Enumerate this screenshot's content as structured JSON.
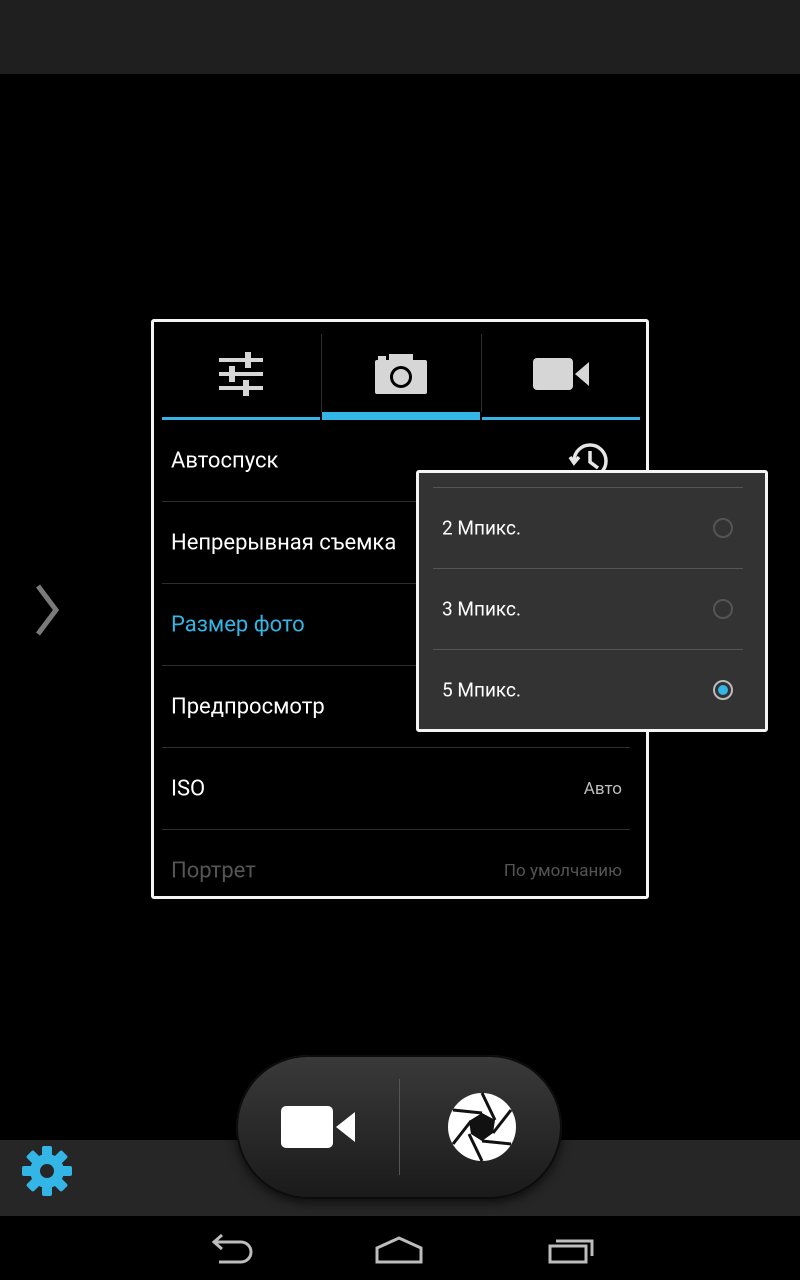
{
  "tabs": [
    {
      "icon": "sliders-icon",
      "active": false
    },
    {
      "icon": "camera-icon",
      "active": true
    },
    {
      "icon": "video-camera-icon",
      "active": false
    }
  ],
  "settings": {
    "timer": {
      "label": "Автоспуск"
    },
    "continuous": {
      "label": "Непрерывная съемка"
    },
    "photo_size": {
      "label": "Размер фото"
    },
    "preview": {
      "label": "Предпросмотр"
    },
    "iso": {
      "label": "ISO",
      "value": "Авто"
    },
    "portrait": {
      "label": "Портрет",
      "value": "По умолчанию"
    }
  },
  "popup": {
    "options": [
      {
        "label": "2 Мпикс.",
        "selected": false
      },
      {
        "label": "3 Мпикс.",
        "selected": false
      },
      {
        "label": "5 Мпикс.",
        "selected": true
      }
    ]
  },
  "colors": {
    "accent": "#33b5e5",
    "panel_border": "#f4f4f4"
  }
}
